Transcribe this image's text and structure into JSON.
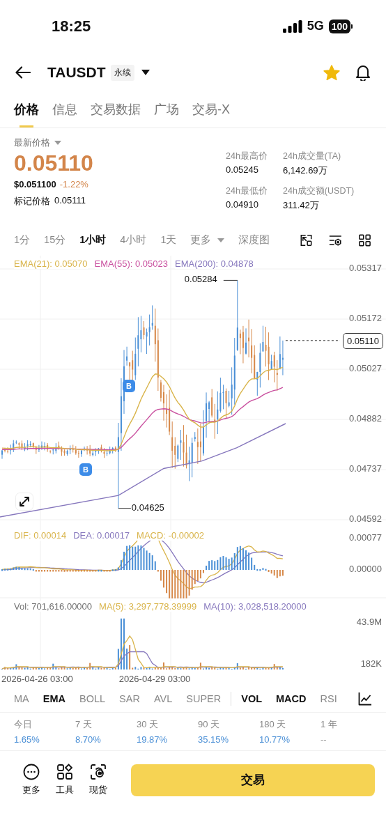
{
  "status_bar": {
    "time": "18:25",
    "network": "5G",
    "battery": "100"
  },
  "header": {
    "symbol": "TAUSDT",
    "badge": "永续",
    "favorite": true
  },
  "tabs": [
    {
      "label": "价格",
      "selected": true
    },
    {
      "label": "信息",
      "selected": false
    },
    {
      "label": "交易数据",
      "selected": false
    },
    {
      "label": "广场",
      "selected": false
    },
    {
      "label": "交易-X",
      "selected": false
    }
  ],
  "price": {
    "label": "最新价格",
    "last": "0.05110",
    "usd": "$0.051100",
    "change": "-1.22%",
    "mark_label": "标记价格",
    "mark": "0.05111"
  },
  "stats": [
    {
      "label": "24h最高价",
      "value": "0.05245"
    },
    {
      "label": "24h成交量(TA)",
      "value": "6,142.69万"
    },
    {
      "label": "24h最低价",
      "value": "0.04910"
    },
    {
      "label": "24h成交额(USDT)",
      "value": "311.42万"
    }
  ],
  "intervals": [
    {
      "label": "1分",
      "selected": false
    },
    {
      "label": "15分",
      "selected": false
    },
    {
      "label": "1小时",
      "selected": true
    },
    {
      "label": "4小时",
      "selected": false
    },
    {
      "label": "1天",
      "selected": false
    }
  ],
  "more_intervals": "更多",
  "depth_chart": "深度图",
  "main_chart": {
    "legend": [
      {
        "text": "EMA(21): 0.05070",
        "color": "#d9b44a"
      },
      {
        "text": "EMA(55): 0.05023",
        "color": "#c9509f"
      },
      {
        "text": "EMA(200): 0.04878",
        "color": "#8677bd"
      }
    ],
    "y_ticks": [
      "0.05317",
      "0.05172",
      "0.05027",
      "0.04882",
      "0.04737",
      "0.04592"
    ],
    "last_price": "0.05110",
    "high_label": "0.05284",
    "low_label": "0.04625",
    "markers": [
      {
        "label": "B"
      },
      {
        "label": "B"
      }
    ]
  },
  "macd": {
    "legend": [
      {
        "text": "DIF: 0.00014",
        "color": "#d9b44a"
      },
      {
        "text": "DEA: 0.00017",
        "color": "#8677bd"
      },
      {
        "text": "MACD: -0.00002",
        "color": "#d9b44a"
      }
    ],
    "y_ticks": [
      "0.00077",
      "0.00000"
    ]
  },
  "volume": {
    "legend": [
      {
        "text": "Vol: 701,616.00000",
        "color": "#707070"
      },
      {
        "text": "MA(5): 3,297,778.39999",
        "color": "#d9b44a"
      },
      {
        "text": "MA(10): 3,028,518.20000",
        "color": "#8677bd"
      }
    ],
    "y_ticks": [
      "43.9M",
      "182K"
    ]
  },
  "time_labels": [
    "2026-04-26 03:00",
    "2026-04-29 03:00"
  ],
  "indicators": [
    {
      "label": "MA",
      "selected": false,
      "kind": "main"
    },
    {
      "label": "EMA",
      "selected": true,
      "kind": "main"
    },
    {
      "label": "BOLL",
      "selected": false,
      "kind": "main"
    },
    {
      "label": "SAR",
      "selected": false,
      "kind": "main"
    },
    {
      "label": "AVL",
      "selected": false,
      "kind": "main"
    },
    {
      "label": "SUPER",
      "selected": false,
      "kind": "main"
    },
    {
      "label": "VOL",
      "selected": true,
      "kind": "sub"
    },
    {
      "label": "MACD",
      "selected": true,
      "kind": "sub"
    },
    {
      "label": "RSI",
      "selected": false,
      "kind": "sub"
    }
  ],
  "periods": [
    {
      "label": "今日",
      "value": "1.65%",
      "color": "#4a8fd6"
    },
    {
      "label": "7 天",
      "value": "8.70%",
      "color": "#4a8fd6"
    },
    {
      "label": "30 天",
      "value": "19.87%",
      "color": "#4a8fd6"
    },
    {
      "label": "90 天",
      "value": "35.15%",
      "color": "#4a8fd6"
    },
    {
      "label": "180 天",
      "value": "10.77%",
      "color": "#4a8fd6"
    },
    {
      "label": "1 年",
      "value": "--",
      "color": "#9a9a9a"
    }
  ],
  "bottom_bar": {
    "actions": [
      {
        "label": "更多",
        "kind": "more"
      },
      {
        "label": "工具",
        "kind": "tools"
      },
      {
        "label": "现货",
        "kind": "spot"
      }
    ],
    "trade_button": "交易"
  }
}
